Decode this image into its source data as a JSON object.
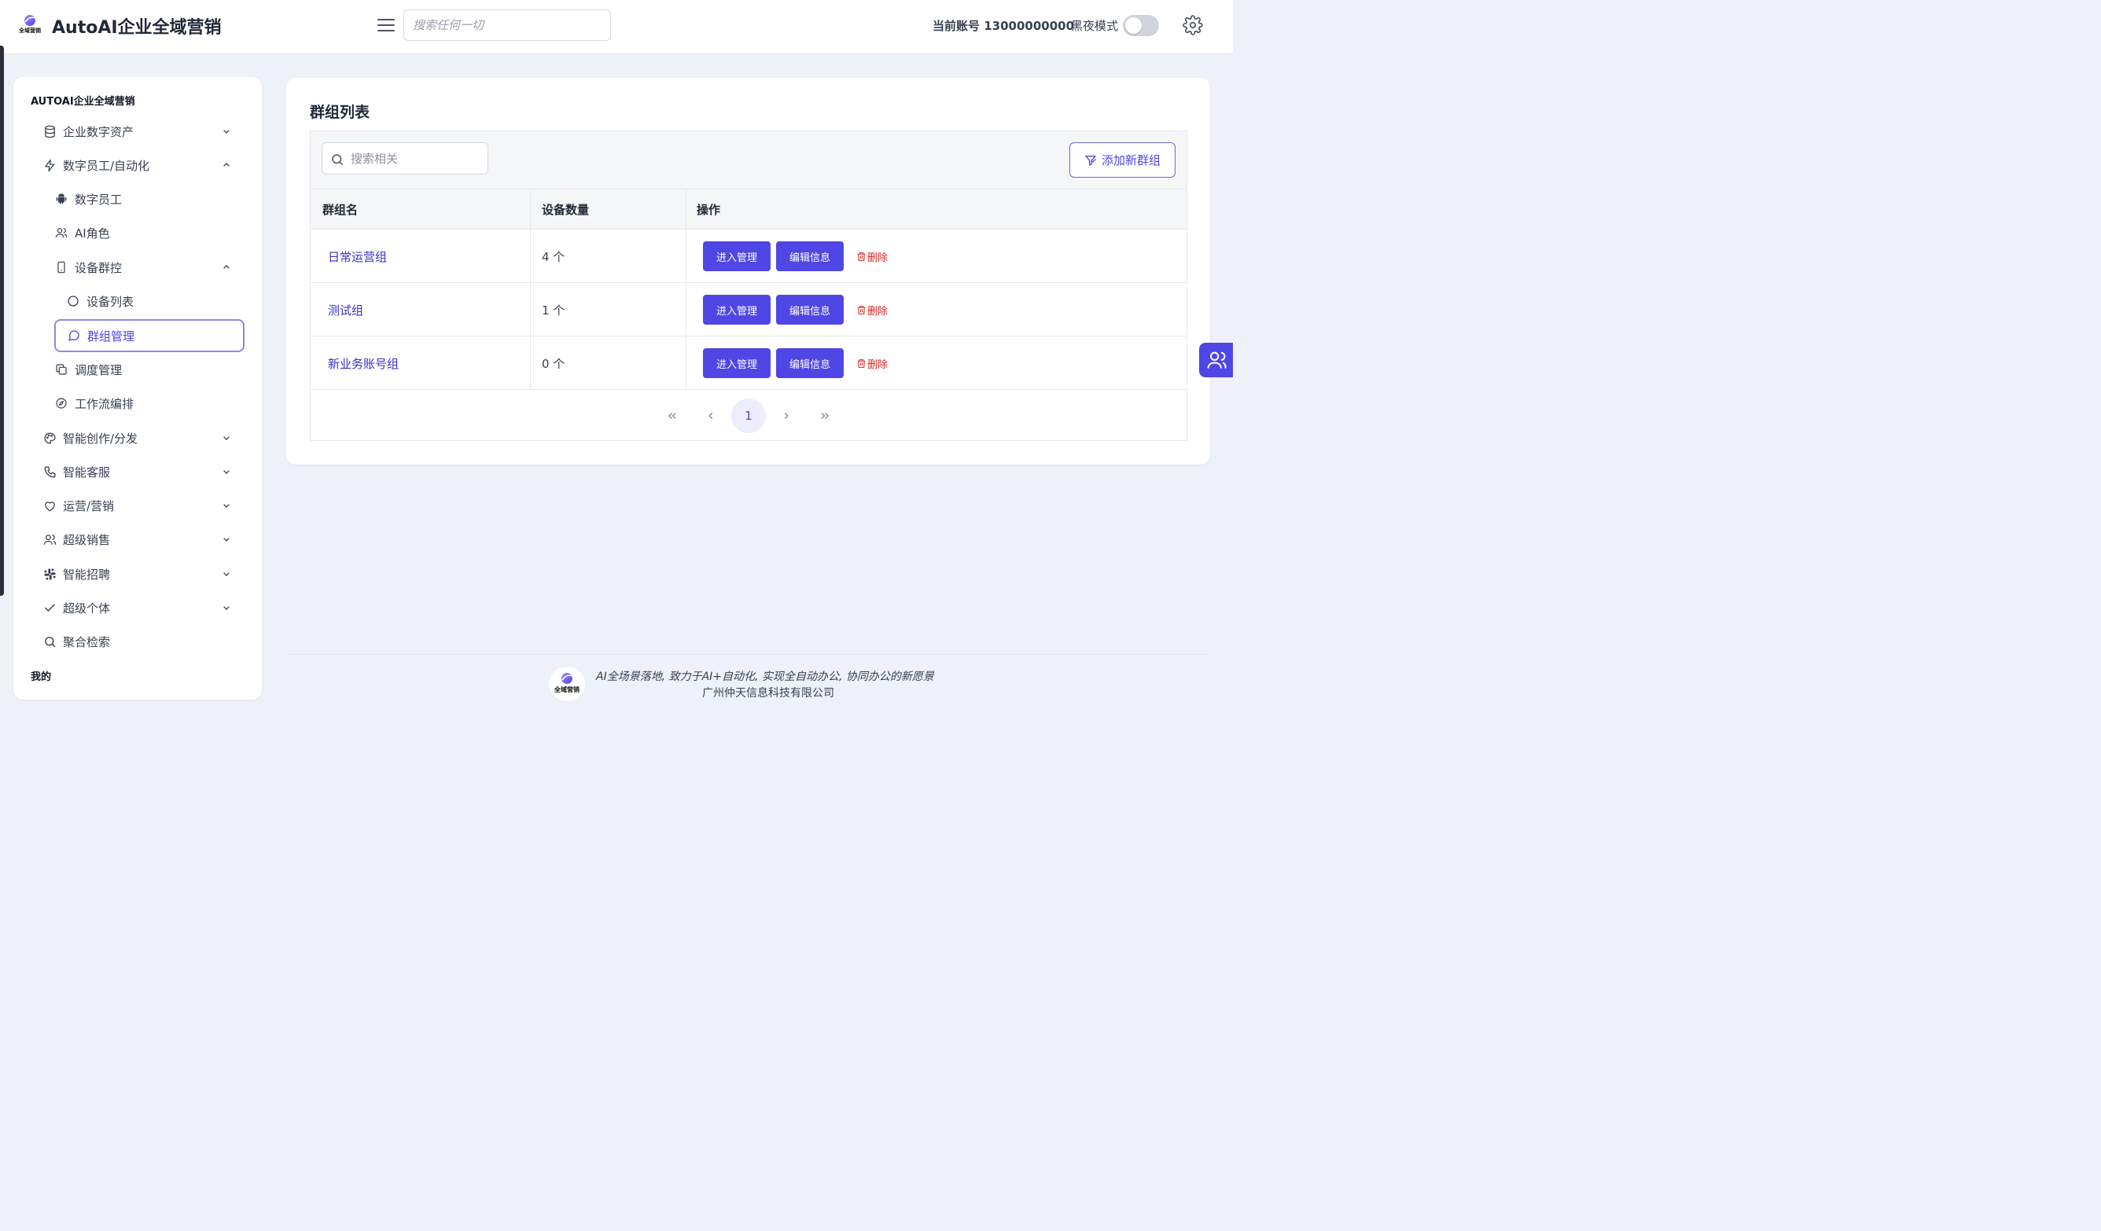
{
  "header": {
    "logo_text": "全域营销",
    "app_title": "AutoAI企业全域营销",
    "search_placeholder": "搜索任何一切",
    "account_label": "当前账号 13000000000",
    "dark_mode_label": "黑夜模式",
    "dark_mode_on": false
  },
  "sidebar": {
    "title": "AUTOAI企业全域营销",
    "items": [
      {
        "label": "企业数字资产",
        "icon": "database-icon",
        "expanded": false
      },
      {
        "label": "数字员工/自动化",
        "icon": "bolt-icon",
        "expanded": true
      },
      {
        "label": "数字员工",
        "icon": "android-icon"
      },
      {
        "label": "AI角色",
        "icon": "users-icon"
      },
      {
        "label": "设备群控",
        "icon": "phone-icon",
        "expanded": true
      },
      {
        "label": "设备列表",
        "icon": "circle-icon"
      },
      {
        "label": "群组管理",
        "icon": "chat-bubble-icon",
        "active": true
      },
      {
        "label": "调度管理",
        "icon": "copy-icon"
      },
      {
        "label": "工作流编排",
        "icon": "compass-icon"
      },
      {
        "label": "智能创作/分发",
        "icon": "palette-icon",
        "expanded": false
      },
      {
        "label": "智能客服",
        "icon": "phone-call-icon",
        "expanded": false
      },
      {
        "label": "运营/营销",
        "icon": "heart-icon",
        "expanded": false
      },
      {
        "label": "超级销售",
        "icon": "users-icon",
        "expanded": false
      },
      {
        "label": "智能招聘",
        "icon": "slack-icon",
        "expanded": false
      },
      {
        "label": "超级个体",
        "icon": "check-icon",
        "expanded": false
      },
      {
        "label": "聚合检索",
        "icon": "search-icon"
      }
    ],
    "my_label": "我的"
  },
  "main": {
    "title": "群组列表",
    "search_placeholder": "搜索相关",
    "add_button": "添加新群组",
    "columns": [
      "群组名",
      "设备数量",
      "操作"
    ],
    "rows": [
      {
        "name": "日常运营组",
        "count": "4 个"
      },
      {
        "name": "测试组",
        "count": "1 个"
      },
      {
        "name": "新业务账号组",
        "count": "0 个"
      }
    ],
    "actions": {
      "manage": "进入管理",
      "edit": "编辑信息",
      "delete": "删除"
    },
    "pagination": {
      "current": "1"
    }
  },
  "footer": {
    "slogan": "AI全场景落地, 致力于AI+自动化, 实现全自动办公, 协同办公的新愿景",
    "company": "广州仲天信息科技有限公司"
  },
  "colors": {
    "accent": "#4f46e5",
    "danger": "#dc2626",
    "background": "#eef1f7"
  }
}
